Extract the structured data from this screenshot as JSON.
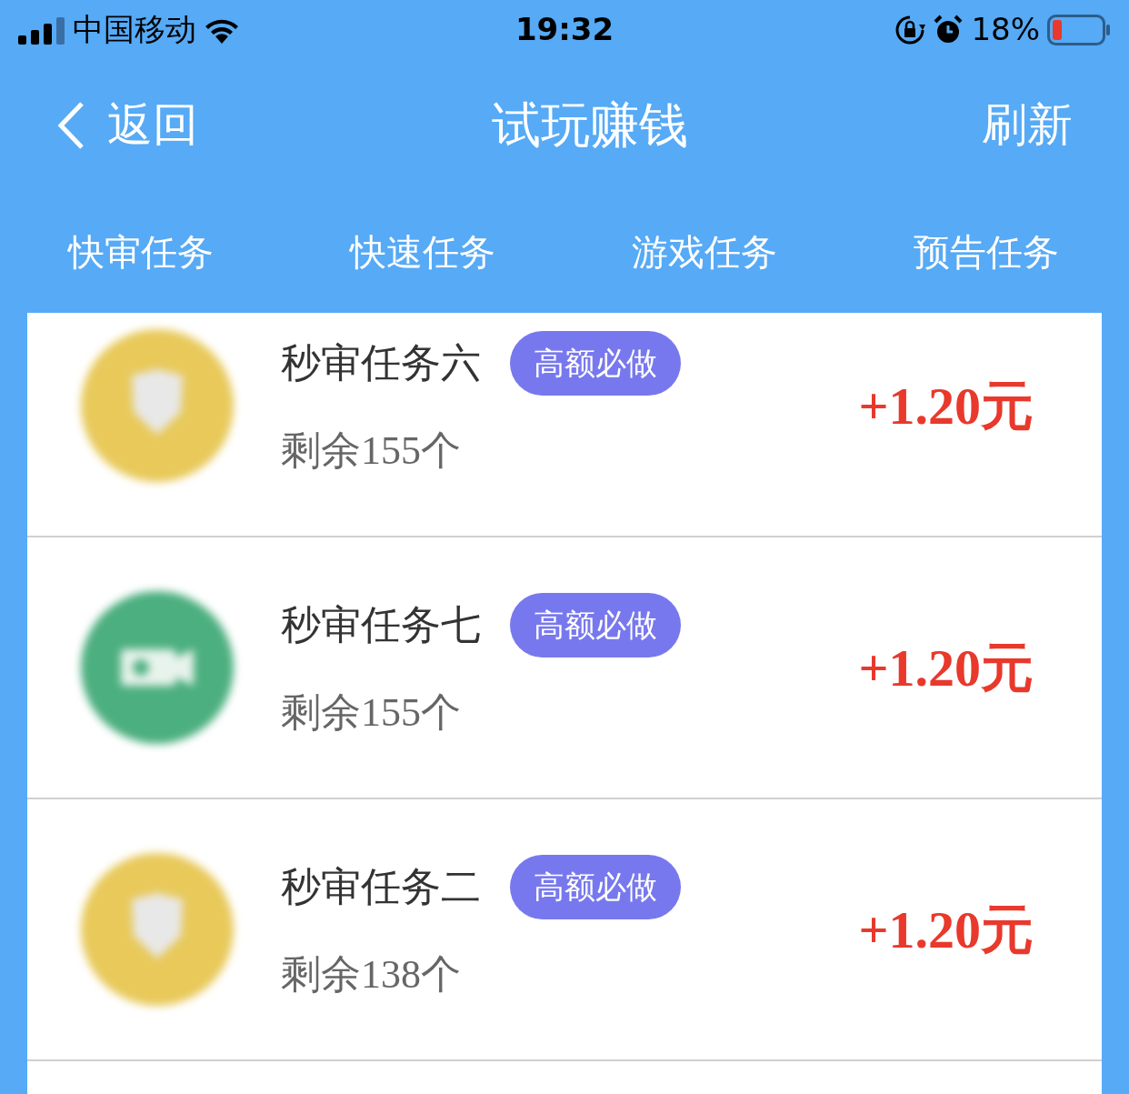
{
  "status_bar": {
    "carrier": "中国移动",
    "time": "19:32",
    "battery": "18%"
  },
  "header": {
    "back": "返回",
    "title": "试玩赚钱",
    "refresh": "刷新"
  },
  "tabs": [
    {
      "label": "快审任务"
    },
    {
      "label": "快速任务"
    },
    {
      "label": "游戏任务"
    },
    {
      "label": "预告任务"
    }
  ],
  "tasks": [
    {
      "title": "秒审任务六",
      "badge": "高额必做",
      "remaining": "剩余155个",
      "reward": "+1.20元",
      "color": "#e8c95a",
      "kind": "shield"
    },
    {
      "title": "秒审任务七",
      "badge": "高额必做",
      "remaining": "剩余155个",
      "reward": "+1.20元",
      "color": "#4caf7f",
      "kind": "camera"
    },
    {
      "title": "秒审任务二",
      "badge": "高额必做",
      "remaining": "剩余138个",
      "reward": "+1.20元",
      "color": "#e8c95a",
      "kind": "shield"
    }
  ]
}
